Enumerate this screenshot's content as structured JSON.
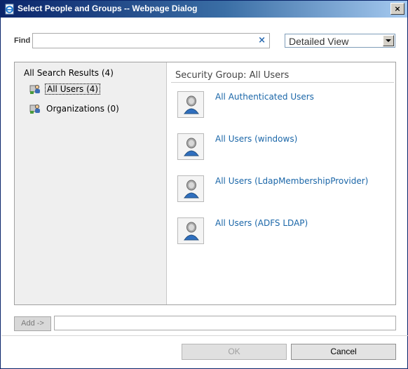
{
  "window": {
    "title": "Select People and Groups -- Webpage Dialog",
    "close_label": "×"
  },
  "search": {
    "label": "Find",
    "value": "",
    "placeholder": "",
    "clear_glyph": "×"
  },
  "view_select": {
    "selected": "Detailed View"
  },
  "results_tree": {
    "root_label": "All Search Results (4)",
    "items": [
      {
        "label": "All Users (4)",
        "icon": "group-icon",
        "selected": true
      },
      {
        "label": "Organizations (0)",
        "icon": "group-icon",
        "selected": false
      }
    ]
  },
  "results_list": {
    "header": "Security Group: All Users",
    "entities": [
      {
        "name": "All Authenticated Users",
        "icon": "user-avatar-icon"
      },
      {
        "name": "All Users (windows)",
        "icon": "user-avatar-icon"
      },
      {
        "name": "All Users (LdapMembershipProvider)",
        "icon": "user-avatar-icon"
      },
      {
        "name": "All Users (ADFS LDAP)",
        "icon": "user-avatar-icon"
      }
    ]
  },
  "add": {
    "button_label": "Add ->",
    "value": ""
  },
  "footer": {
    "ok_label": "OK",
    "cancel_label": "Cancel"
  },
  "colors": {
    "link": "#1a66a8",
    "titlebar_start": "#0a246a",
    "pane_background": "#efefef"
  }
}
